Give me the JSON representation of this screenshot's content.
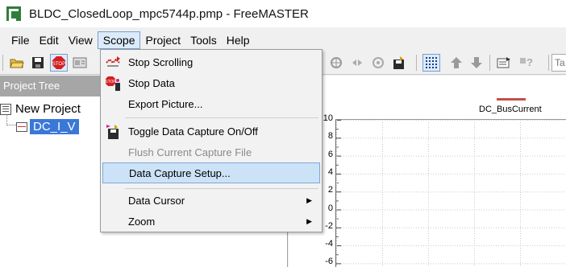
{
  "window": {
    "title": "BLDC_ClosedLoop_mpc5744p.pmp - FreeMASTER"
  },
  "menu": {
    "items": [
      {
        "label": "File"
      },
      {
        "label": "Edit"
      },
      {
        "label": "View"
      },
      {
        "label": "Scope"
      },
      {
        "label": "Project"
      },
      {
        "label": "Tools"
      },
      {
        "label": "Help"
      }
    ],
    "active": "Scope"
  },
  "toolbar": {
    "trailing_text": "Ta"
  },
  "project_tree": {
    "header": "Project Tree",
    "root": "New Project",
    "child": "DC_I_V"
  },
  "scope_menu": {
    "items": [
      {
        "label": "Stop Scrolling",
        "icon": "stop-scrolling-icon"
      },
      {
        "label": "Stop Data",
        "icon": "stop-data-icon"
      },
      {
        "label": "Export Picture..."
      },
      {
        "label": "Toggle Data Capture On/Off",
        "icon": "data-capture-icon"
      },
      {
        "label": "Flush Current Capture File",
        "disabled": true
      },
      {
        "label": "Data Capture Setup...",
        "highlighted": true
      },
      {
        "label": "Data Cursor",
        "submenu": true
      },
      {
        "label": "Zoom",
        "submenu": true
      }
    ]
  },
  "scope": {
    "legend": "DC_BusCurrent",
    "legend_color": "#c0504d",
    "y_ticks": [
      "10",
      "8",
      "6",
      "4",
      "2",
      "0",
      "-2",
      "-4",
      "-6"
    ]
  }
}
